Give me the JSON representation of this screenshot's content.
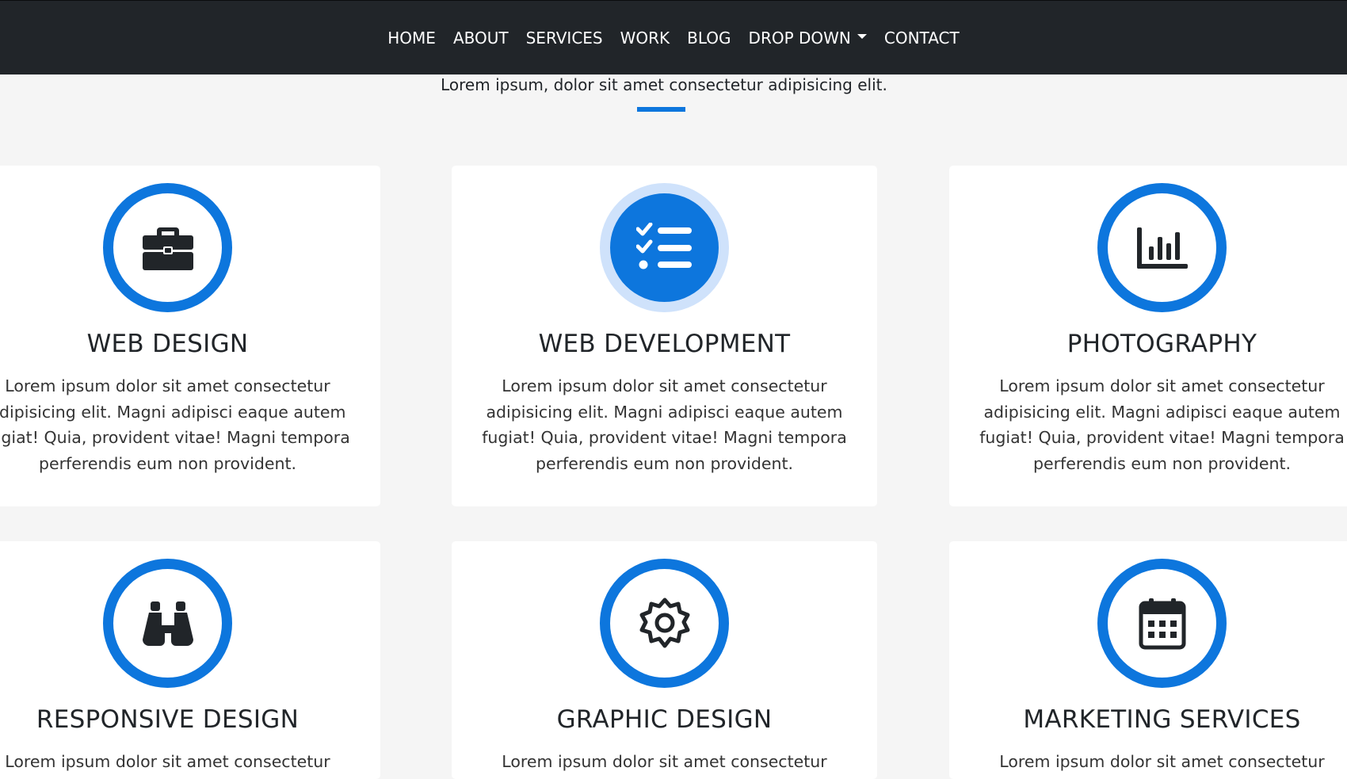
{
  "nav": {
    "items": [
      "HOME",
      "ABOUT",
      "SERVICES",
      "WORK",
      "BLOG",
      "DROP DOWN",
      "CONTACT"
    ]
  },
  "section": {
    "subtitle": "Lorem ipsum, dolor sit amet consectetur adipisicing elit."
  },
  "services": [
    {
      "title": "WEB DESIGN",
      "icon": "briefcase-icon",
      "text": "Lorem ipsum dolor sit amet consectetur adipisicing elit. Magni adipisci eaque autem fugiat! Quia, provident vitae! Magni tempora perferendis eum non provident."
    },
    {
      "title": "WEB DEVELOPMENT",
      "icon": "checklist-icon",
      "text": "Lorem ipsum dolor sit amet consectetur adipisicing elit. Magni adipisci eaque autem fugiat! Quia, provident vitae! Magni tempora perferendis eum non provident."
    },
    {
      "title": "PHOTOGRAPHY",
      "icon": "bar-chart-icon",
      "text": "Lorem ipsum dolor sit amet consectetur adipisicing elit. Magni adipisci eaque autem fugiat! Quia, provident vitae! Magni tempora perferendis eum non provident."
    },
    {
      "title": "RESPONSIVE DESIGN",
      "icon": "binoculars-icon",
      "text": "Lorem ipsum dolor sit amet consectetur adipisicing"
    },
    {
      "title": "GRAPHIC DESIGN",
      "icon": "gear-icon",
      "text": "Lorem ipsum dolor sit amet consectetur adipisicing"
    },
    {
      "title": "MARKETING SERVICES",
      "icon": "calendar-icon",
      "text": "Lorem ipsum dolor sit amet consectetur adipisicing"
    }
  ],
  "colors": {
    "accent": "#0d76dd",
    "accent_light": "#cfe2fb",
    "navbar": "#212529",
    "background": "#f5f5f5"
  }
}
